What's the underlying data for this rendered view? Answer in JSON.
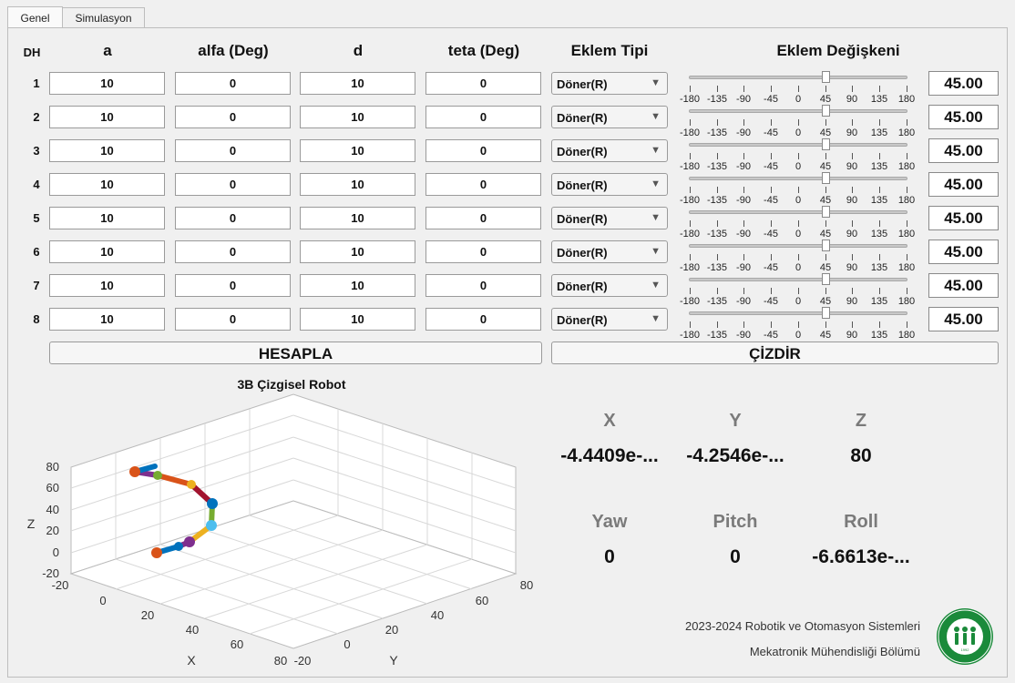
{
  "tabs": [
    "Genel",
    "Simulasyon"
  ],
  "headers": {
    "dh": "DH",
    "a": "a",
    "alfa": "alfa (Deg)",
    "d": "d",
    "teta": "teta (Deg)",
    "joint_type": "Eklem Tipi",
    "joint_var": "Eklem Değişkeni"
  },
  "rows": [
    {
      "num": "1",
      "a": "10",
      "alfa": "0",
      "d": "10",
      "teta": "0",
      "type": "Döner(R)",
      "value": "45.00",
      "slider": 45
    },
    {
      "num": "2",
      "a": "10",
      "alfa": "0",
      "d": "10",
      "teta": "0",
      "type": "Döner(R)",
      "value": "45.00",
      "slider": 45
    },
    {
      "num": "3",
      "a": "10",
      "alfa": "0",
      "d": "10",
      "teta": "0",
      "type": "Döner(R)",
      "value": "45.00",
      "slider": 45
    },
    {
      "num": "4",
      "a": "10",
      "alfa": "0",
      "d": "10",
      "teta": "0",
      "type": "Döner(R)",
      "value": "45.00",
      "slider": 45
    },
    {
      "num": "5",
      "a": "10",
      "alfa": "0",
      "d": "10",
      "teta": "0",
      "type": "Döner(R)",
      "value": "45.00",
      "slider": 45
    },
    {
      "num": "6",
      "a": "10",
      "alfa": "0",
      "d": "10",
      "teta": "0",
      "type": "Döner(R)",
      "value": "45.00",
      "slider": 45
    },
    {
      "num": "7",
      "a": "10",
      "alfa": "0",
      "d": "10",
      "teta": "0",
      "type": "Döner(R)",
      "value": "45.00",
      "slider": 45
    },
    {
      "num": "8",
      "a": "10",
      "alfa": "0",
      "d": "10",
      "teta": "0",
      "type": "Döner(R)",
      "value": "45.00",
      "slider": 45
    }
  ],
  "slider_ticks": [
    "-180",
    "-135",
    "-90",
    "-45",
    "0",
    "45",
    "90",
    "135",
    "180"
  ],
  "slider_range": [
    -180,
    180
  ],
  "buttons": {
    "calculate": "HESAPLA",
    "draw": "ÇİZDİR"
  },
  "plot": {
    "title": "3B Çizgisel Robot",
    "z_label": "Z",
    "x_label": "X",
    "y_label": "Y",
    "z_ticks": [
      "80",
      "60",
      "40",
      "20",
      "0",
      "-20"
    ],
    "x_ticks": [
      "-20",
      "0",
      "20",
      "40",
      "60",
      "80"
    ],
    "y_ticks": [
      "-20",
      "0",
      "20",
      "40",
      "60",
      "80"
    ]
  },
  "results": {
    "x_label": "X",
    "x_value": "-4.4409e-...",
    "y_label": "Y",
    "y_value": "-4.2546e-...",
    "z_label": "Z",
    "z_value": "80",
    "yaw_label": "Yaw",
    "yaw_value": "0",
    "pitch_label": "Pitch",
    "pitch_value": "0",
    "roll_label": "Roll",
    "roll_value": "-6.6613e-..."
  },
  "footer": {
    "line1": "2023-2024 Robotik ve Otomasyon Sistemleri",
    "line2": "Mekatronik Mühendisliği Bölümü"
  },
  "logo_text": "KOCAELİ ÜNİVERSİTESİ",
  "logo_year": "1992",
  "colors": {
    "logo_green": "#1a8a3a",
    "link_blue": "#0072bd",
    "link_orange": "#d95319",
    "link_yellow": "#edb120",
    "link_purple": "#7e2f8e",
    "link_green": "#77ac30",
    "link_cyan": "#4dbeee",
    "link_red": "#a2142f"
  }
}
